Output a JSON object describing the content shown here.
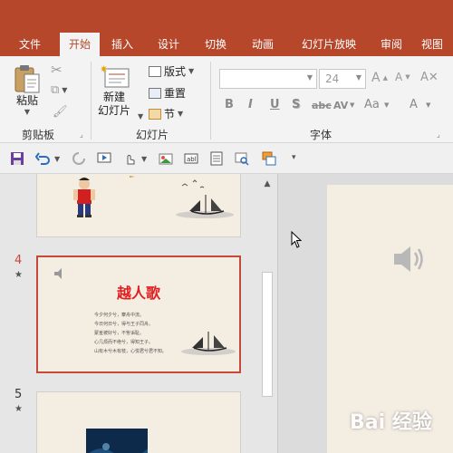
{
  "tabs": [
    "文件",
    "开始",
    "插入",
    "设计",
    "切换",
    "动画",
    "幻灯片放映",
    "审阅",
    "视图"
  ],
  "active_tab": "开始",
  "clipboard": {
    "paste_label": "粘贴",
    "group_label": "剪贴板"
  },
  "slides_group": {
    "new_slide_line1": "新建",
    "new_slide_line2": "幻灯片",
    "layout_label": "版式",
    "reset_label": "重置",
    "section_label": "节",
    "group_label": "幻灯片"
  },
  "font_group": {
    "font_name": "",
    "font_size": "24",
    "group_label": "字体",
    "buttons": [
      "B",
      "I",
      "U",
      "S",
      "AV",
      "Aa",
      "A"
    ]
  },
  "thumbnails": {
    "slide4_number": "4",
    "slide4_title": "越人歌",
    "slide4_poem": [
      "今夕何夕兮，搴舟中流。",
      "今日何日兮，得与王子同舟。",
      "蒙羞被好兮，不訾诟耻。",
      "心几烦而不绝兮，得知王子。",
      "山有木兮木有枝，心悦君兮君不知。"
    ],
    "slide5_number": "5",
    "star": "★"
  },
  "watermark": "Bai 经验",
  "colors": {
    "ribbon_red": "#b7472a",
    "title_red": "#e02020",
    "selected_border": "#c5493a"
  }
}
